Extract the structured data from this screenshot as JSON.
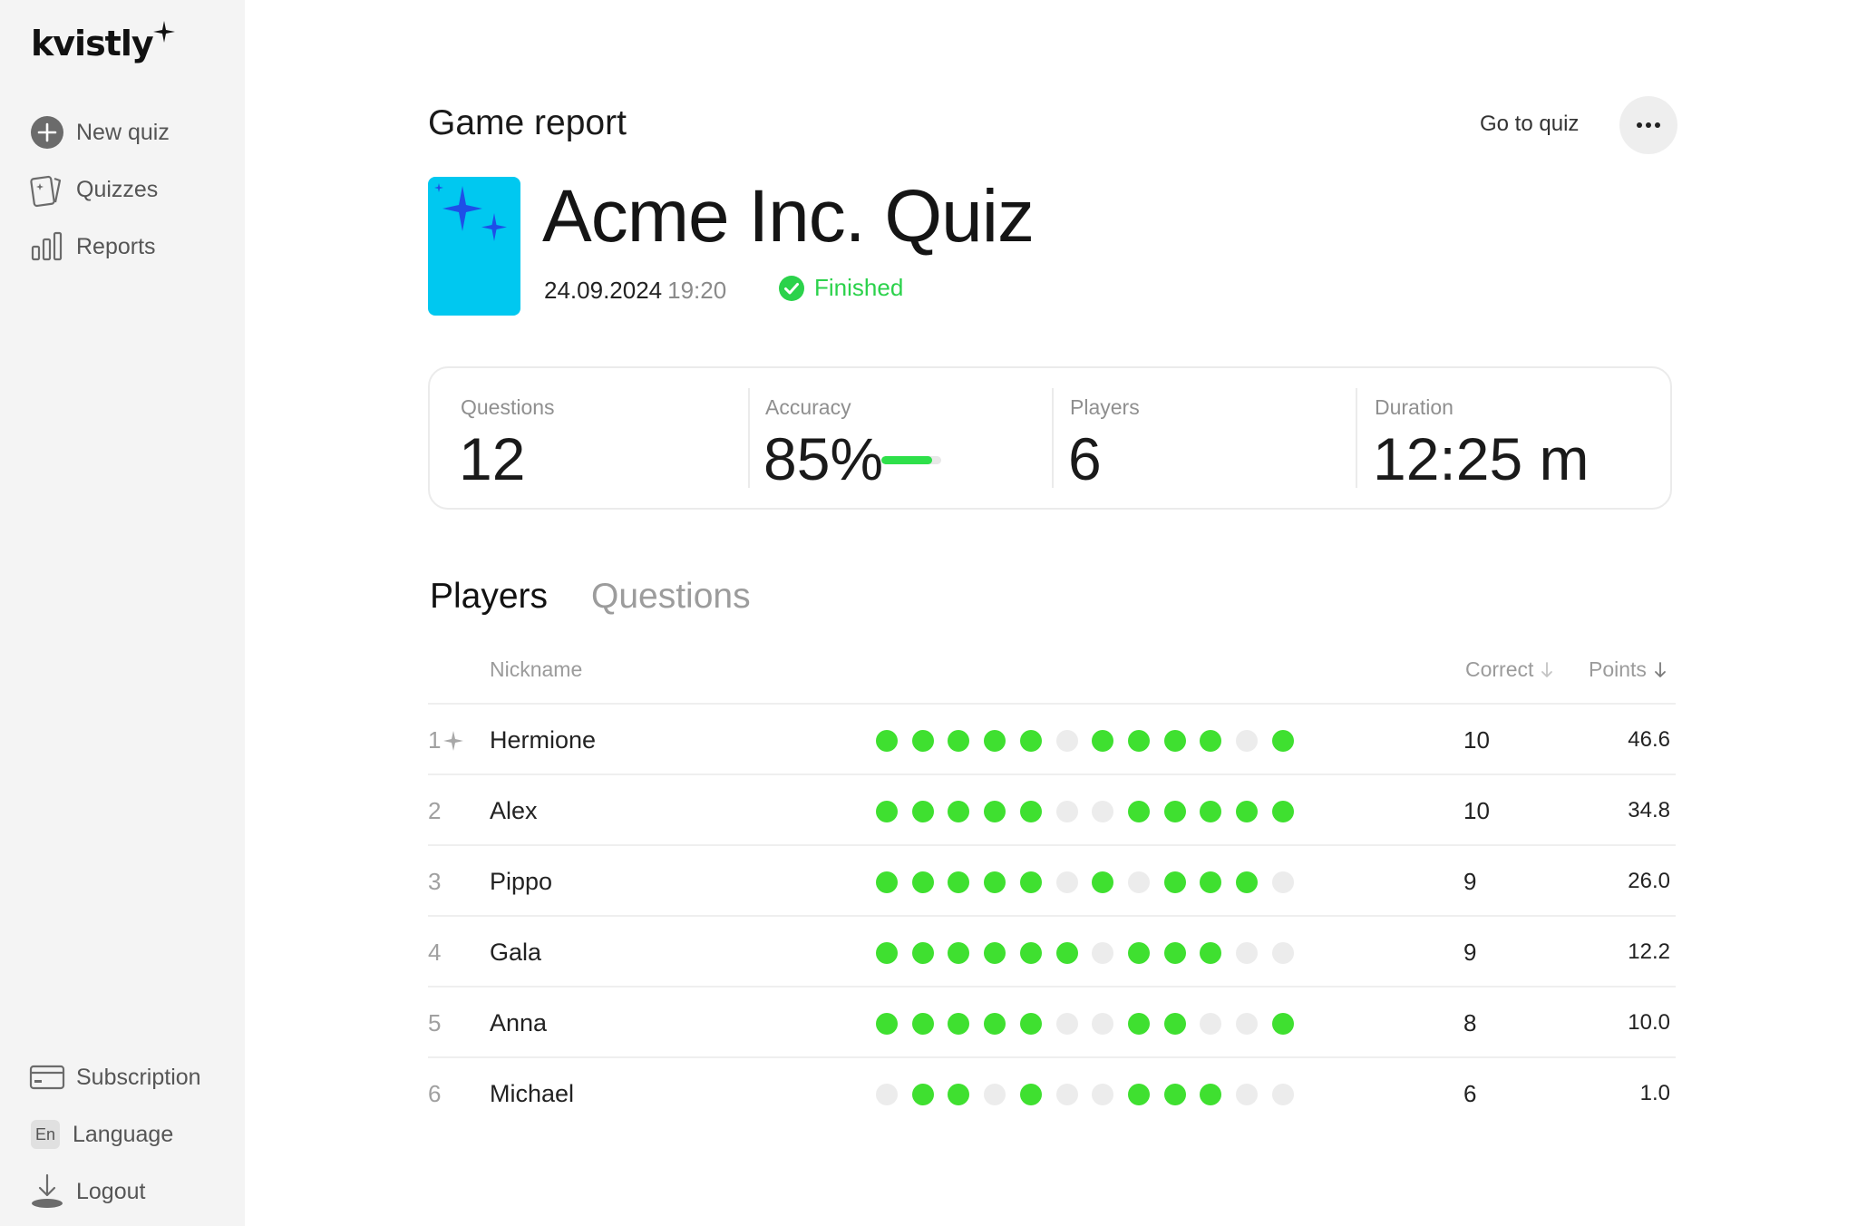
{
  "app": {
    "logo": "kvistly"
  },
  "sidebar": {
    "items": [
      {
        "label": "New quiz",
        "icon": "plus-circle-icon"
      },
      {
        "label": "Quizzes",
        "icon": "cards-icon"
      },
      {
        "label": "Reports",
        "icon": "bar-chart-icon"
      }
    ],
    "bottom": [
      {
        "label": "Subscription",
        "icon": "credit-card-icon"
      },
      {
        "label": "Language",
        "icon": "language-icon",
        "badge": "En"
      },
      {
        "label": "Logout",
        "icon": "logout-icon"
      }
    ]
  },
  "header": {
    "title": "Game report",
    "go_to_quiz": "Go to quiz",
    "more_icon": "more-dots-icon"
  },
  "quiz": {
    "title": "Acme Inc. Quiz",
    "date": "24.09.2024",
    "time": "19:20",
    "status": "Finished",
    "status_color": "#2bd24b",
    "thumb_color": "#00c8f0"
  },
  "stats": {
    "questions": {
      "label": "Questions",
      "value": "12"
    },
    "accuracy": {
      "label": "Accuracy",
      "value": "85%",
      "fraction": 0.85
    },
    "players": {
      "label": "Players",
      "value": "6"
    },
    "duration": {
      "label": "Duration",
      "value": "12:25 m"
    }
  },
  "tabs": [
    {
      "label": "Players",
      "active": true
    },
    {
      "label": "Questions",
      "active": false
    }
  ],
  "table": {
    "headers": {
      "nickname": "Nickname",
      "correct": "Correct",
      "points": "Points"
    },
    "colors": {
      "correct": "#3fe030",
      "incorrect": "#ececec"
    },
    "rows": [
      {
        "rank": "1",
        "nickname": "Hermione",
        "answers": [
          1,
          1,
          1,
          1,
          1,
          0,
          1,
          1,
          1,
          1,
          0,
          1
        ],
        "correct": "10",
        "points": "46.6"
      },
      {
        "rank": "2",
        "nickname": "Alex",
        "answers": [
          1,
          1,
          1,
          1,
          1,
          0,
          0,
          1,
          1,
          1,
          1,
          1
        ],
        "correct": "10",
        "points": "34.8"
      },
      {
        "rank": "3",
        "nickname": "Pippo",
        "answers": [
          1,
          1,
          1,
          1,
          1,
          0,
          1,
          0,
          1,
          1,
          1,
          0
        ],
        "correct": "9",
        "points": "26.0"
      },
      {
        "rank": "4",
        "nickname": "Gala",
        "answers": [
          1,
          1,
          1,
          1,
          1,
          1,
          0,
          1,
          1,
          1,
          0,
          0
        ],
        "correct": "9",
        "points": "12.2"
      },
      {
        "rank": "5",
        "nickname": "Anna",
        "answers": [
          1,
          1,
          1,
          1,
          1,
          0,
          0,
          1,
          1,
          0,
          0,
          1
        ],
        "correct": "8",
        "points": "10.0"
      },
      {
        "rank": "6",
        "nickname": "Michael",
        "answers": [
          0,
          1,
          1,
          0,
          1,
          0,
          0,
          1,
          1,
          1,
          0,
          0
        ],
        "correct": "6",
        "points": "1.0"
      }
    ]
  }
}
